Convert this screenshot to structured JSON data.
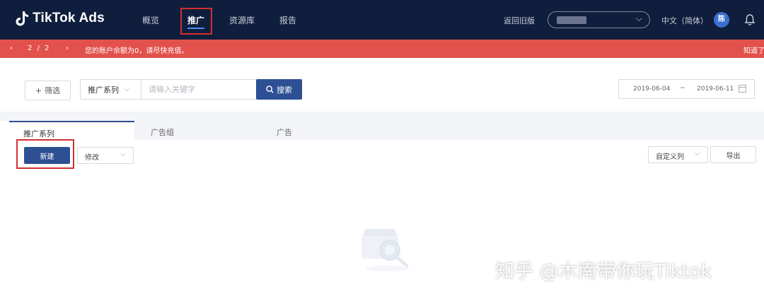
{
  "header": {
    "logo_text": "TikTok Ads",
    "nav": [
      {
        "label": "概览"
      },
      {
        "label": "推广",
        "active": true
      },
      {
        "label": "资源库"
      },
      {
        "label": "报告"
      }
    ],
    "back_to_old": "返回旧版",
    "language": "中文（简体）",
    "avatar_initial": "陈"
  },
  "alert": {
    "prev_icon": "chevron-left-icon",
    "page": "2 / 2",
    "next_icon": "chevron-right-icon",
    "message": "您的账户余额为0，请尽快充值。",
    "dismiss": "知道了"
  },
  "filter": {
    "filter_button": "筛选",
    "scope_select": "推广系列",
    "search_placeholder": "请输入关键字",
    "search_button": "搜索",
    "date_start": "2019-06-04",
    "date_separator": "~",
    "date_end": "2019-06-11"
  },
  "tabs": [
    {
      "label": "推广系列",
      "active": true
    },
    {
      "label": "广告组"
    },
    {
      "label": "广告"
    }
  ],
  "toolbar": {
    "new_button": "新建",
    "modify_select": "修改",
    "custom_columns": "自定义列",
    "export_button": "导出"
  },
  "watermark": "知乎 @木南带你玩Tiktok",
  "colors": {
    "topbar_bg": "#0f1e3c",
    "alert_bg": "#e2514c",
    "primary": "#2d4f93",
    "highlight": "#d32f2f"
  }
}
